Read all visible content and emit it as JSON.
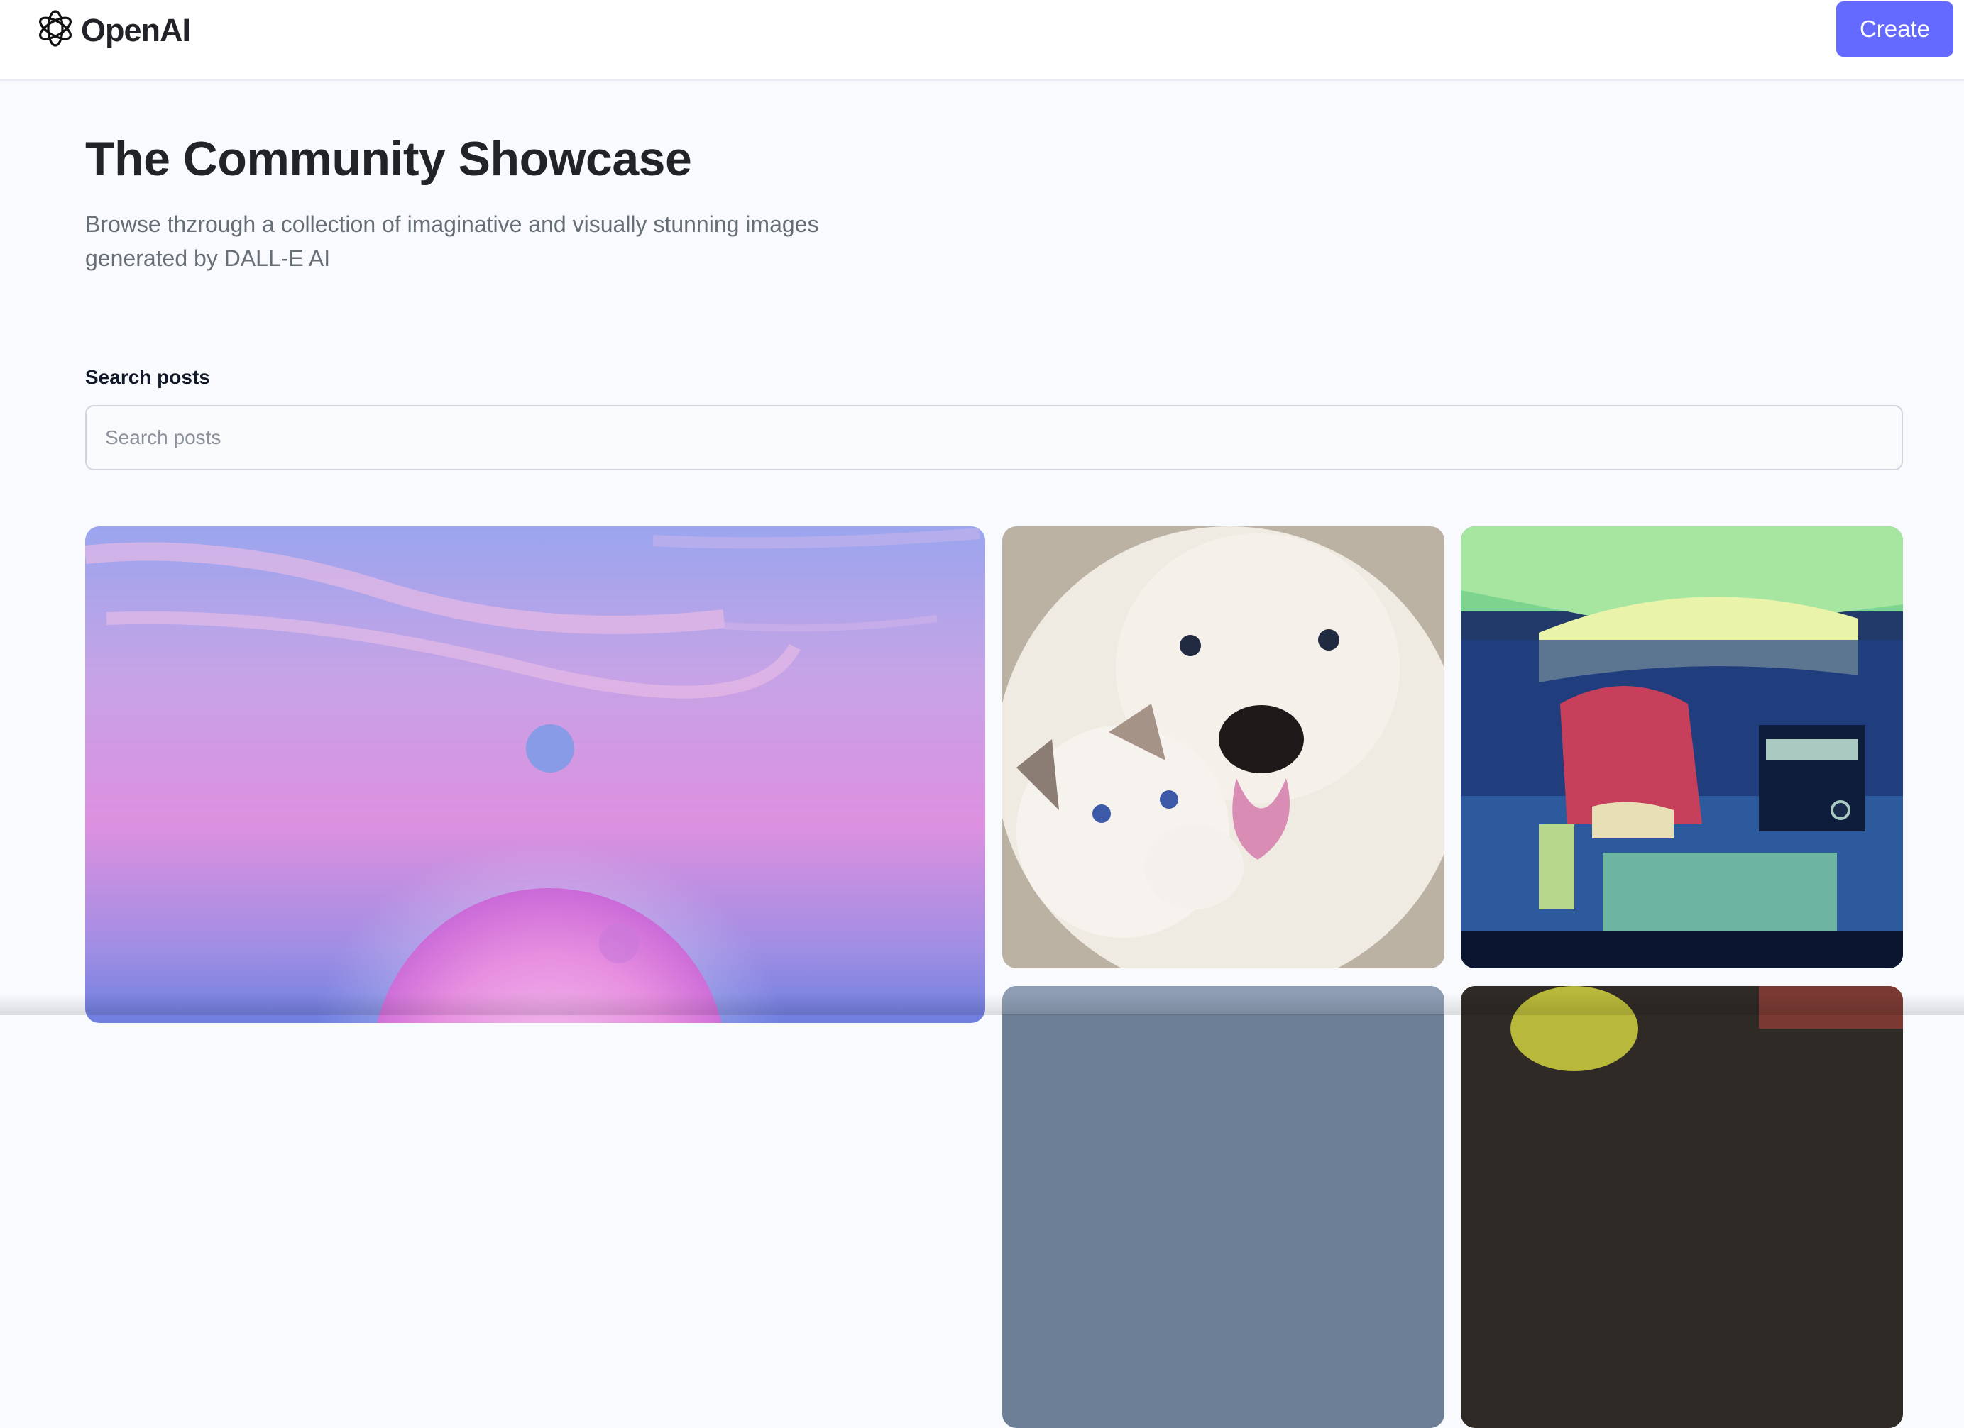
{
  "header": {
    "brand_name": "OpenAI",
    "create_label": "Create"
  },
  "main": {
    "title": "The Community Showcase",
    "subtitle": "Browse thzrough a collection of imaginative and visually stunning images generated by DALL-E AI"
  },
  "search": {
    "label": "Search posts",
    "placeholder": "Search posts",
    "value": ""
  },
  "gallery": {
    "cards": [
      {
        "subject": "pink sunset sky with two moons"
      },
      {
        "subject": "white dog and cat"
      },
      {
        "subject": "person at food stall"
      },
      {
        "subject": "partially visible image"
      },
      {
        "subject": "partially visible image"
      }
    ]
  },
  "colors": {
    "accent": "#6469ff",
    "page_background": "#f9fafe",
    "title": "#222328",
    "subtitle": "#666e75"
  }
}
